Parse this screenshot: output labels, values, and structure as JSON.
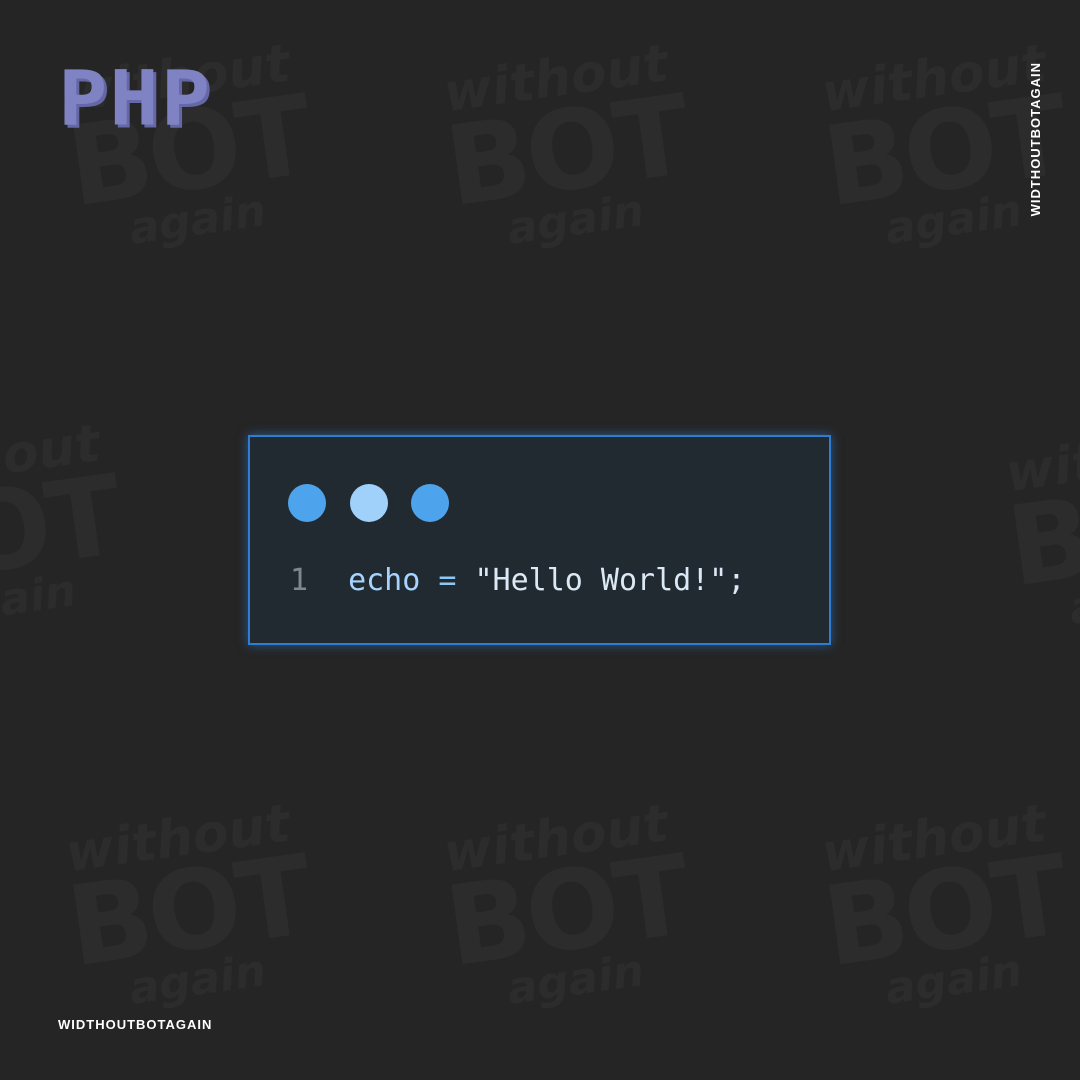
{
  "logo": {
    "text": "PHP",
    "color": "#8083c3"
  },
  "brand": {
    "side": "WIDTHOUTBOTAGAIN",
    "bottom": "WIDTHOUTBOTAGAIN"
  },
  "watermark": {
    "line1": "without",
    "line2": "BOT",
    "line3": "again"
  },
  "window": {
    "dots": [
      "#4ea4ec",
      "#9fd1fb",
      "#4ea4ec"
    ],
    "border_color": "#2f7dd0",
    "background": "#222a31"
  },
  "code": {
    "line_number": "1",
    "keyword": "echo",
    "operator": " = ",
    "string": "\"Hello World!\"",
    "terminator": ";"
  }
}
